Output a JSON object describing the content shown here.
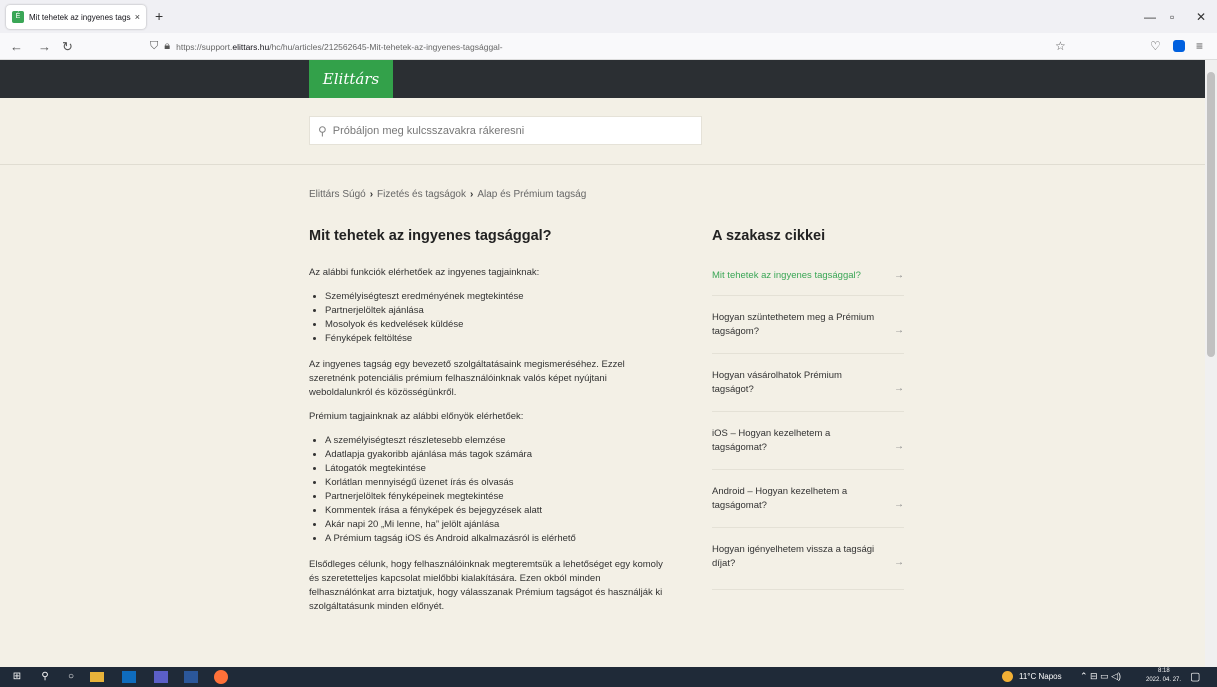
{
  "browser": {
    "tab_title": "Mit tehetek az ingyenes tagsággal?",
    "tab_close": "×",
    "new_tab": "+",
    "url_prefix": "https://support.",
    "url_host": "elittars.hu",
    "url_path": "/hc/hu/articles/212562645-Mit-tehetek-az-ingyenes-tagsággal-"
  },
  "site": {
    "logo": "Elittárs",
    "search_placeholder": "Próbáljon meg kulcsszavakra rákeresni"
  },
  "breadcrumb": [
    "Elittárs Súgó",
    "Fizetés és tagságok",
    "Alap és Prémium tagság"
  ],
  "article": {
    "title": "Mit tehetek az ingyenes tagsággal?",
    "intro": "Az alábbi funkciók elérhetőek az ingyenes tagjainknak:",
    "free_features": [
      "Személyiségteszt eredményének megtekintése",
      "Partnerjelöltek ajánlása",
      "Mosolyok és kedvelések küldése",
      "Fényképek feltöltése"
    ],
    "para2": "Az ingyenes tagság egy bevezető szolgáltatásaink megismeréséhez. Ezzel szeretnénk potenciális prémium felhasználóinknak valós képet nyújtani weboldalunkról és közösségünkről.",
    "premium_intro": "Prémium tagjainknak az alábbi előnyök elérhetőek:",
    "premium_features": [
      "A személyiségteszt részletesebb elemzése",
      "Adatlapja gyakoribb ajánlása más tagok számára",
      "Látogatók megtekintése",
      "Korlátlan mennyiségű üzenet írás és olvasás",
      "Partnerjelöltek fényképeinek megtekintése",
      "Kommentek írása a fényképek és bejegyzések alatt",
      "Akár napi 20 „Mi lenne, ha” jelölt ajánlása",
      "A Prémium tagság iOS és Android alkalmazásról is elérhető"
    ],
    "para4": " Elsődleges célunk, hogy felhasználóinknak megteremtsük a lehetőséget egy komoly és szeretetteljes kapcsolat mielőbbi kialakítására. Ezen okból minden felhasználónkat arra biztatjuk, hogy válasszanak Prémium tagságot és használják ki szolgáltatásunk minden előnyét."
  },
  "sidebar": {
    "heading": "A szakasz cikkei",
    "items": [
      "Mit tehetek az ingyenes tagsággal?",
      "Hogyan szüntethetem meg a Prémium tagságom?",
      "Hogyan vásárolhatok Prémium tagságot?",
      "iOS – Hogyan kezelhetem a tagságomat?",
      "Android – Hogyan kezelhetem a tagságomat?",
      "Hogyan igényelhetem vissza a tagsági díjat?"
    ],
    "arrow": "→"
  },
  "taskbar": {
    "weather": "11°C  Napos",
    "time": "8:18",
    "date": "2022. 04. 27."
  }
}
